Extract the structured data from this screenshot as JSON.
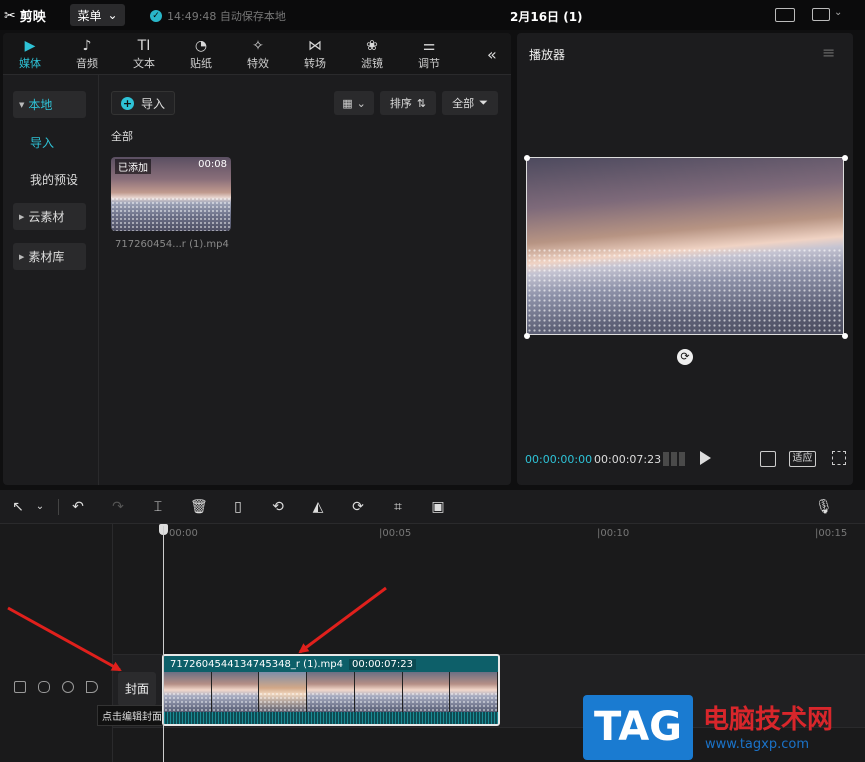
{
  "app": {
    "name": "剪映",
    "menu_label": "菜单",
    "save_status": "14:49:48 自动保存本地",
    "project_title": "2月16日 (1)"
  },
  "tabs": [
    {
      "label": "媒体",
      "icon": "media-icon"
    },
    {
      "label": "音频",
      "icon": "audio-icon"
    },
    {
      "label": "文本",
      "icon": "text-icon"
    },
    {
      "label": "贴纸",
      "icon": "sticker-icon"
    },
    {
      "label": "特效",
      "icon": "effects-icon"
    },
    {
      "label": "转场",
      "icon": "transition-icon"
    },
    {
      "label": "滤镜",
      "icon": "filter-icon"
    },
    {
      "label": "调节",
      "icon": "adjust-icon"
    }
  ],
  "side_nav": {
    "local": "本地",
    "import": "导入",
    "my_presets": "我的预设",
    "cloud": "云素材",
    "library": "素材库"
  },
  "media": {
    "import_label": "导入",
    "sort_label": "排序",
    "filter_label": "全部",
    "all_label": "全部",
    "item": {
      "badge": "已添加",
      "duration": "00:08",
      "filename": "717260454...r (1).mp4"
    }
  },
  "player": {
    "title": "播放器",
    "time_current": "00:00:00:00",
    "time_total": "00:00:07:23",
    "fit_label": "适应"
  },
  "timeline": {
    "ticks": [
      "00:00",
      "|00:05",
      "|00:10",
      "|00:15"
    ],
    "cover_label": "封面",
    "cover_tooltip": "点击编辑封面",
    "clip": {
      "name": "7172604544134745348_r (1).mp4",
      "duration": "00:00:07:23"
    }
  },
  "watermark": {
    "tag": "TAG",
    "title": "电脑技术网",
    "url": "www.tagxp.com"
  },
  "colors": {
    "accent": "#2ec2d6",
    "arrow": "#e0201c",
    "clip_header": "#0d5f69"
  }
}
